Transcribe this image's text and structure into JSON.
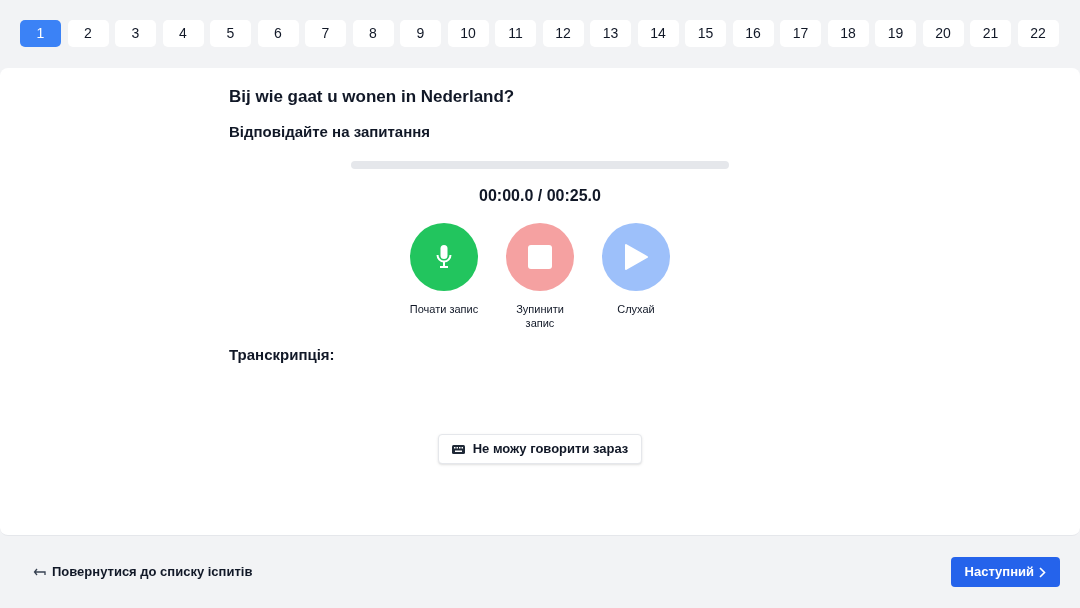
{
  "question_tabs": [
    {
      "label": "1",
      "selected": true
    },
    {
      "label": "2",
      "selected": false
    },
    {
      "label": "3",
      "selected": false
    },
    {
      "label": "4",
      "selected": false
    },
    {
      "label": "5",
      "selected": false
    },
    {
      "label": "6",
      "selected": false
    },
    {
      "label": "7",
      "selected": false
    },
    {
      "label": "8",
      "selected": false
    },
    {
      "label": "9",
      "selected": false
    },
    {
      "label": "10",
      "selected": false
    },
    {
      "label": "11",
      "selected": false
    },
    {
      "label": "12",
      "selected": false
    },
    {
      "label": "13",
      "selected": false
    },
    {
      "label": "14",
      "selected": false
    },
    {
      "label": "15",
      "selected": false
    },
    {
      "label": "16",
      "selected": false
    },
    {
      "label": "17",
      "selected": false
    },
    {
      "label": "18",
      "selected": false
    },
    {
      "label": "19",
      "selected": false
    },
    {
      "label": "20",
      "selected": false
    },
    {
      "label": "21",
      "selected": false
    },
    {
      "label": "22",
      "selected": false
    }
  ],
  "question": "Bij wie gaat u wonen in Nederland?",
  "instruction": "Відповідайте на запитання",
  "recorder": {
    "progress": {
      "level": 0
    },
    "time": "00:00.0 / 00:25.0",
    "controls": [
      {
        "kind": "record",
        "label": "Почати запис",
        "disabled": false
      },
      {
        "kind": "stop",
        "label": "Зупинити запис",
        "disabled": true
      },
      {
        "kind": "play",
        "label": "Слухай",
        "disabled": true
      }
    ]
  },
  "transcription_label": "Транскрипція:",
  "cant_speak_button": "Не можу говорити зараз",
  "footer": {
    "back_link": "Повернутися до списку іспитів",
    "next_button": "Наступний"
  }
}
